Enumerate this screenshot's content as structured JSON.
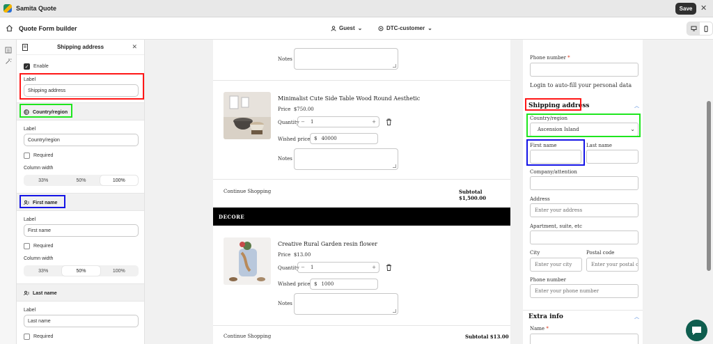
{
  "app": {
    "title": "Samita Quote",
    "save_label": "Save"
  },
  "navbar": {
    "title": "Quote Form builder",
    "guest_label": "Guest",
    "segment_label": "DTC-customer"
  },
  "panel": {
    "title": "Shipping address",
    "enable_label": "Enable",
    "label_label": "Label",
    "label_value": "Shipping address",
    "country": {
      "section_label": "Country/region",
      "label_label": "Label",
      "label_value": "Country/region",
      "required_label": "Required",
      "width_label": "Column width",
      "widths": [
        "33%",
        "50%",
        "100%"
      ],
      "selected_width": 2
    },
    "first_name": {
      "section_label": "First name",
      "label_label": "Label",
      "label_value": "First name",
      "required_label": "Required",
      "width_label": "Column width",
      "widths": [
        "33%",
        "50%",
        "100%"
      ],
      "selected_width": 1
    },
    "last_name": {
      "section_label": "Last name",
      "label_label": "Label",
      "label_value": "Last name",
      "required_label": "Required"
    }
  },
  "cart": {
    "notes_label": "Notes",
    "quantity_label": "Quantity",
    "wished_price_label": "Wished price",
    "price_label": "Price",
    "currency_symbol": "$",
    "continue_label": "Continue Shopping",
    "items": [
      {
        "name": "Minimalist Cute Side Table Wood Round Aesthetic",
        "price": "$750.00",
        "quantity": "1",
        "wished_price": "40000"
      },
      {
        "name": "Creative Rural Garden resin flower",
        "price": "$13.00",
        "quantity": "1",
        "wished_price": "1000"
      }
    ],
    "subtotal_1": "Subtotal $1,500.00",
    "subtotal_2": "Subtotal $13.00",
    "banner": "DECORE"
  },
  "form": {
    "phone_label": "Phone number",
    "login_text": "Login to auto-fill your personal data",
    "shipping_heading": "Shipping address",
    "country_label": "Country/region",
    "country_value": "Ascension Island",
    "first_name_label": "First name",
    "last_name_label": "Last name",
    "company_label": "Company/attention",
    "address_label": "Address",
    "address_placeholder": "Enter your address",
    "apt_label": "Apartment, suite, etc",
    "city_label": "City",
    "city_placeholder": "Enter your city",
    "postal_label": "Postal code",
    "postal_placeholder": "Enter your postal co",
    "phone2_label": "Phone number",
    "phone2_placeholder": "Enter your phone number",
    "extra_heading": "Extra info",
    "name_label": "Name"
  },
  "colors": {
    "highlight_red": "#ff1616",
    "highlight_green": "#1ee61e",
    "highlight_blue": "#1414e6",
    "chat": "#0f5e4f"
  },
  "icons": [
    "app-logo-icon",
    "home-icon",
    "user-icon",
    "segment-icon",
    "desktop-icon",
    "mobile-icon",
    "list-icon",
    "magic-icon",
    "back-icon",
    "close-icon",
    "globe-icon",
    "person-icon",
    "trash-icon",
    "chevron-up-icon",
    "chat-icon"
  ]
}
